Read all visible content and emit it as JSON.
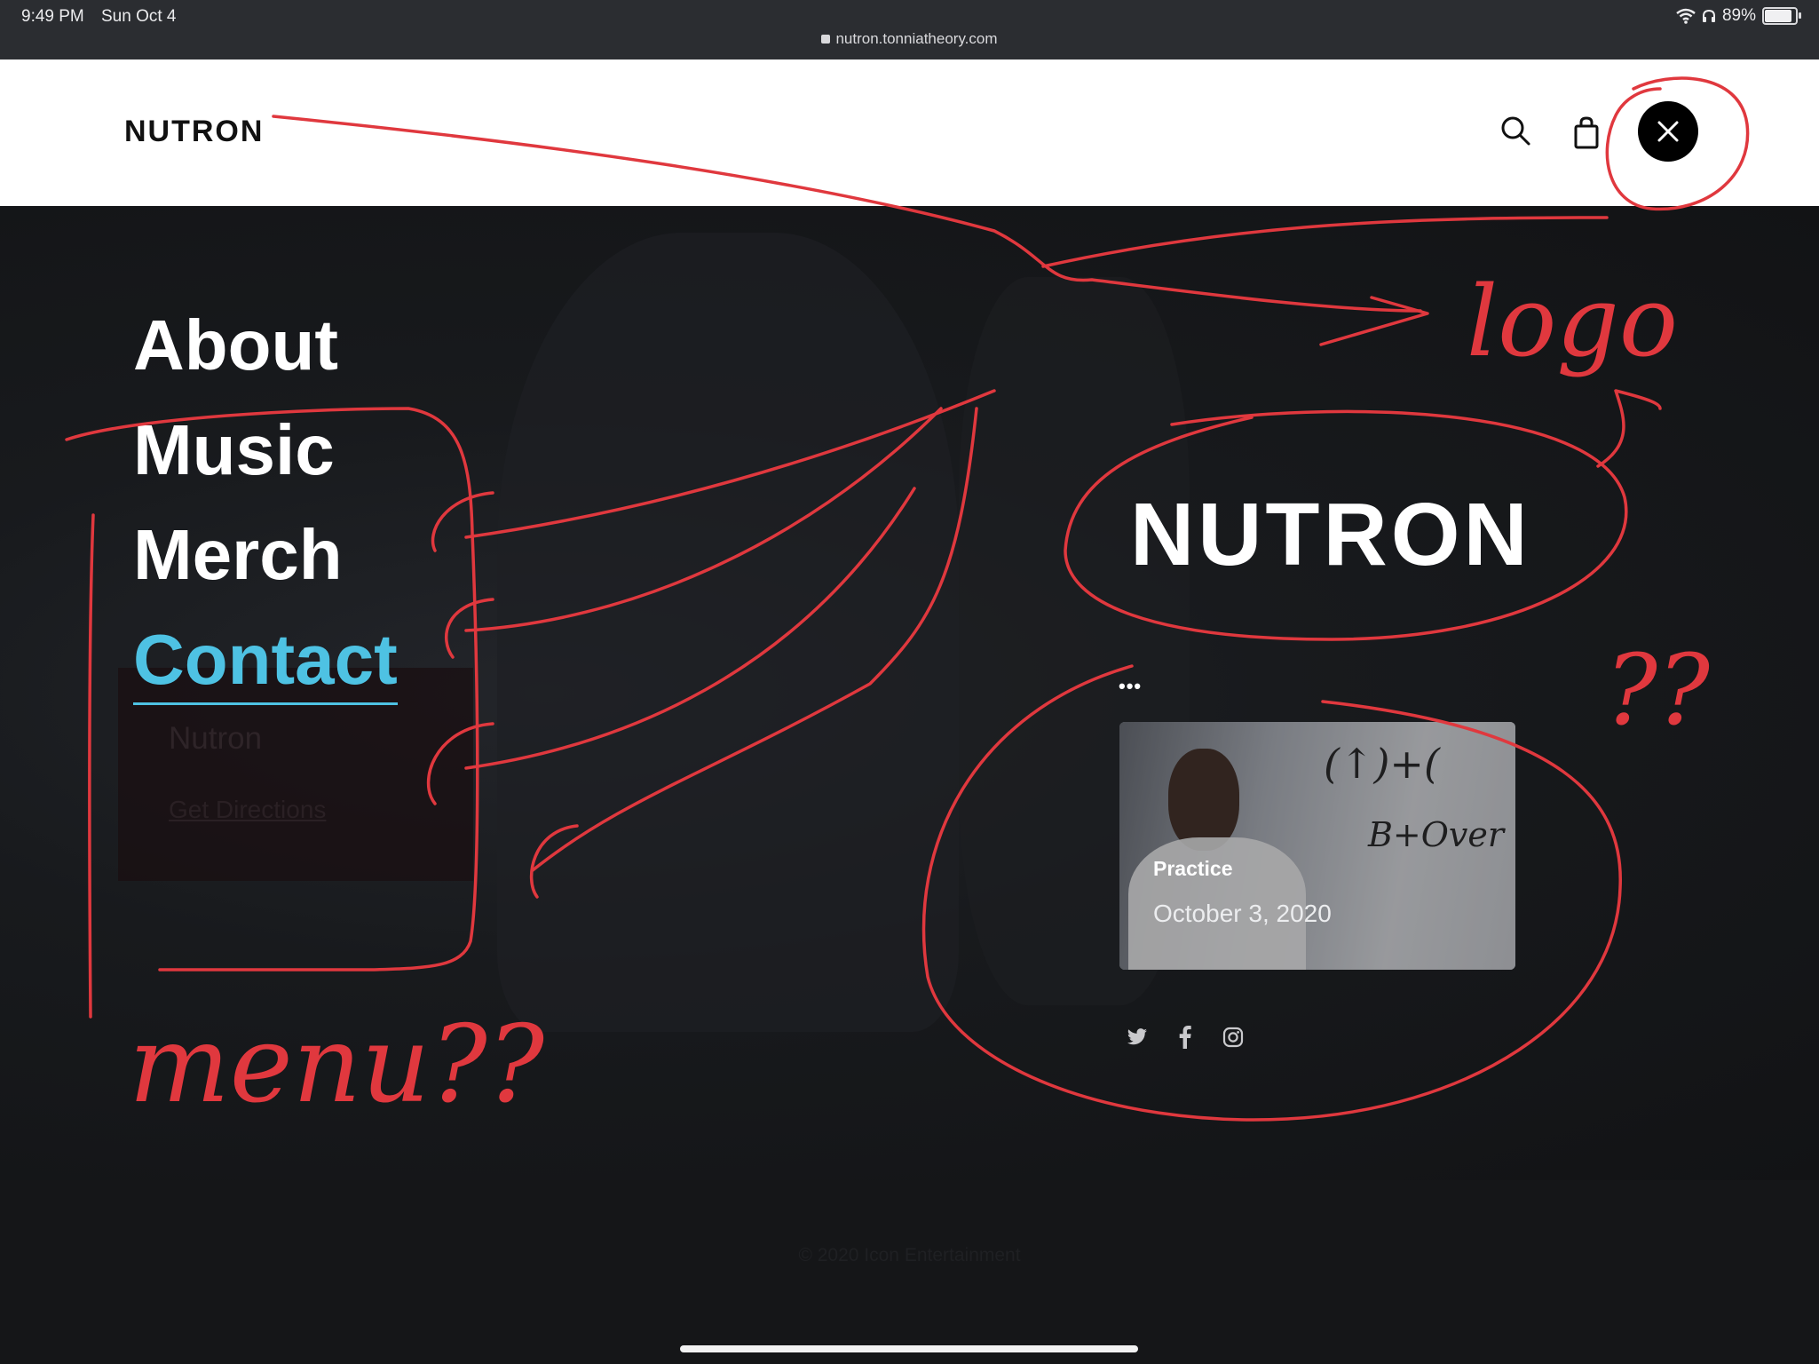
{
  "status_bar": {
    "time": "9:49 PM",
    "date": "Sun Oct 4",
    "url": "nutron.tonniatheory.com",
    "battery": "89%",
    "battery_level": 0.89,
    "icons": [
      "wifi-icon",
      "headphones-icon",
      "battery-icon",
      "lock-icon"
    ]
  },
  "header": {
    "logo": "NUTRON",
    "icons": [
      "search-icon",
      "shopping-bag-icon",
      "close-icon"
    ]
  },
  "menu": {
    "items": [
      "About",
      "Music",
      "Merch",
      "Contact"
    ],
    "active_index": 3,
    "ghost_title": "Nutron",
    "ghost_link": "Get Directions"
  },
  "sidebar": {
    "logo": "NUTRON",
    "more_label": "•••",
    "post": {
      "category": "Practice",
      "date": "October 3, 2020",
      "board_text_1": "(↑)+(",
      "board_text_2": "B+Over"
    },
    "social_icons": [
      "twitter-icon",
      "facebook-icon",
      "instagram-icon"
    ]
  },
  "footer": {
    "copyright": "© 2020 Icon Entertainment"
  },
  "annotations": {
    "logo_note": "logo",
    "question_note": "??",
    "menu_note": "menu??"
  },
  "colors": {
    "accent": "#4ec2e3",
    "annotation": "#e0383e",
    "background": "#151618",
    "header_bg": "#ffffff"
  }
}
